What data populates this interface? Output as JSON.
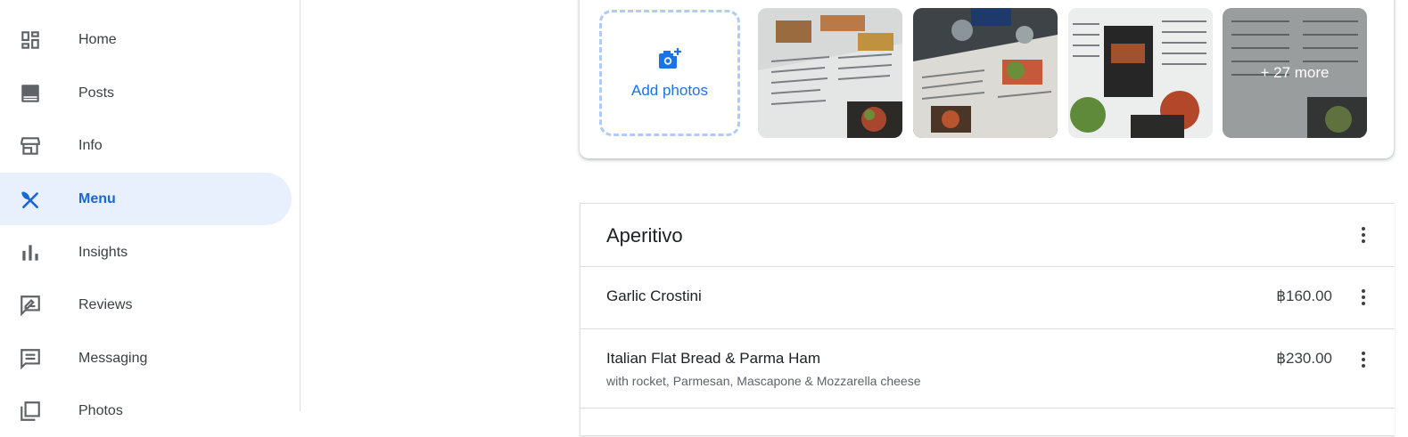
{
  "sidebar": {
    "items": [
      {
        "label": "Home",
        "icon": "dashboard-icon"
      },
      {
        "label": "Posts",
        "icon": "posts-icon"
      },
      {
        "label": "Info",
        "icon": "storefront-icon"
      },
      {
        "label": "Menu",
        "icon": "utensils-icon",
        "active": true
      },
      {
        "label": "Insights",
        "icon": "bar-chart-icon"
      },
      {
        "label": "Reviews",
        "icon": "rate-review-icon"
      },
      {
        "label": "Messaging",
        "icon": "message-icon"
      },
      {
        "label": "Photos",
        "icon": "photos-icon"
      }
    ]
  },
  "photos": {
    "add_label": "Add photos",
    "more_label": "+ 27 more"
  },
  "menu_section": {
    "title": "Aperitivo",
    "items": [
      {
        "name": "Garlic Crostini",
        "price": "฿160.00",
        "description": ""
      },
      {
        "name": "Italian Flat Bread & Parma Ham",
        "price": "฿230.00",
        "description": "with rocket, Parmesan, Mascapone & Mozzarella cheese"
      }
    ]
  },
  "colors": {
    "accent": "#1a73e8",
    "active_bg": "#e8f0fe",
    "active_text": "#1967d2"
  }
}
